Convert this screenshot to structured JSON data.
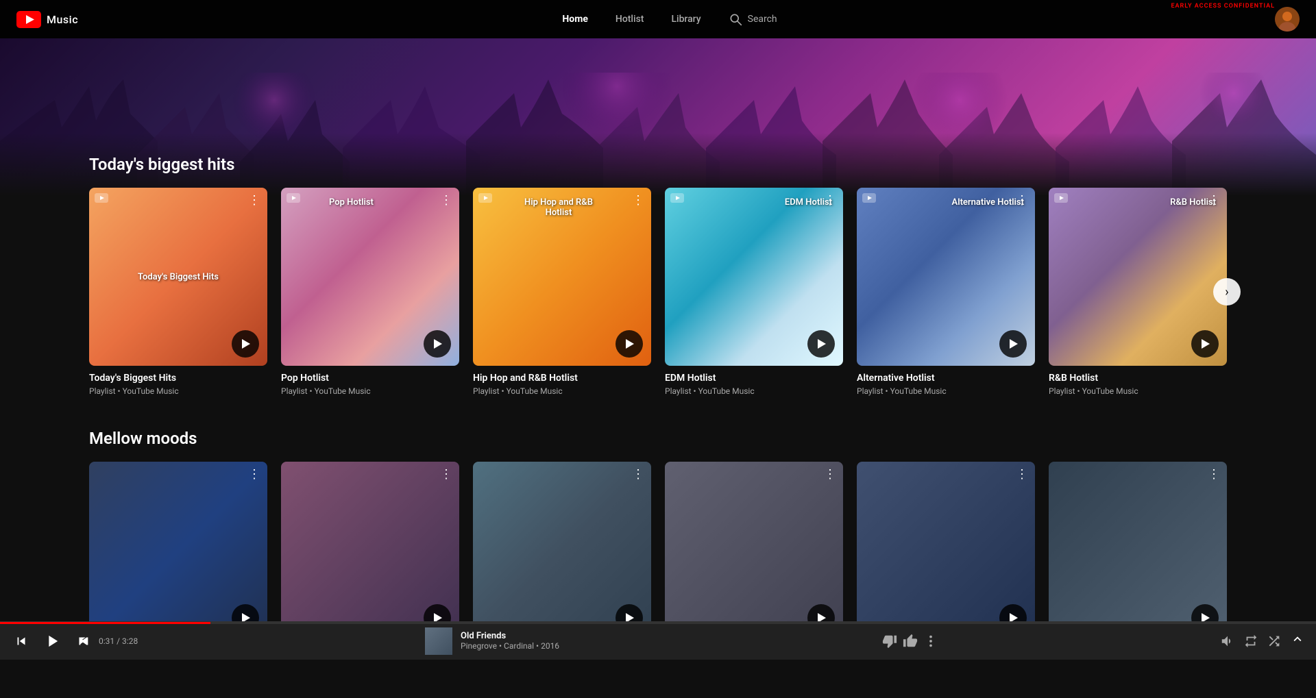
{
  "meta": {
    "early_access": "EARLY ACCESS CONFIDENTIAL"
  },
  "navbar": {
    "logo_text": "Music",
    "links": [
      {
        "label": "Home",
        "active": true
      },
      {
        "label": "Hotlist",
        "active": false
      },
      {
        "label": "Library",
        "active": false
      }
    ],
    "search_label": "Search"
  },
  "hero": {
    "overlay": ""
  },
  "sections": [
    {
      "id": "todays-biggest-hits",
      "title": "Today's biggest hits",
      "cards": [
        {
          "id": 1,
          "name": "Today's Biggest Hits",
          "meta": "Playlist • YouTube Music",
          "color_class": "card-1",
          "label_overlay": "Today's Biggest Hits"
        },
        {
          "id": 2,
          "name": "Pop Hotlist",
          "meta": "Playlist • YouTube Music",
          "color_class": "card-2",
          "label_overlay": "Pop Hotlist"
        },
        {
          "id": 3,
          "name": "Hip Hop and R&B Hotlist",
          "meta": "Playlist • YouTube Music",
          "color_class": "card-3",
          "label_overlay": "Hip Hop and R&B Hotlist"
        },
        {
          "id": 4,
          "name": "EDM Hotlist",
          "meta": "Playlist • YouTube Music",
          "color_class": "card-4",
          "label_overlay": "EDM Hotlist"
        },
        {
          "id": 5,
          "name": "Alternative Hotlist",
          "meta": "Playlist • YouTube Music",
          "color_class": "card-5",
          "label_overlay": "Alternative Hotlist"
        },
        {
          "id": 6,
          "name": "R&B Hotlist",
          "meta": "Playlist • YouTube Music",
          "color_class": "card-6",
          "label_overlay": "R&B Hotlist"
        }
      ]
    },
    {
      "id": "mellow-moods",
      "title": "Mellow moods",
      "cards": [
        {
          "id": 1,
          "name": "",
          "meta": "",
          "color_class": "card-m1",
          "label_overlay": ""
        },
        {
          "id": 2,
          "name": "",
          "meta": "",
          "color_class": "card-m2",
          "label_overlay": ""
        },
        {
          "id": 3,
          "name": "",
          "meta": "",
          "color_class": "card-m3",
          "label_overlay": ""
        },
        {
          "id": 4,
          "name": "",
          "meta": "",
          "color_class": "card-m4",
          "label_overlay": ""
        },
        {
          "id": 5,
          "name": "",
          "meta": "",
          "color_class": "card-m5",
          "label_overlay": ""
        },
        {
          "id": 6,
          "name": "",
          "meta": "",
          "color_class": "card-m6",
          "label_overlay": ""
        }
      ]
    }
  ],
  "player": {
    "song_title": "Old Friends",
    "artist": "Pinegrove",
    "album": "Cardinal",
    "year": "2016",
    "artist_album_year": "Pinegrove • Cardinal • 2016",
    "current_time": "0:31",
    "total_time": "3:28",
    "time_display": "0:31 / 3:28",
    "progress_pct": 16
  }
}
